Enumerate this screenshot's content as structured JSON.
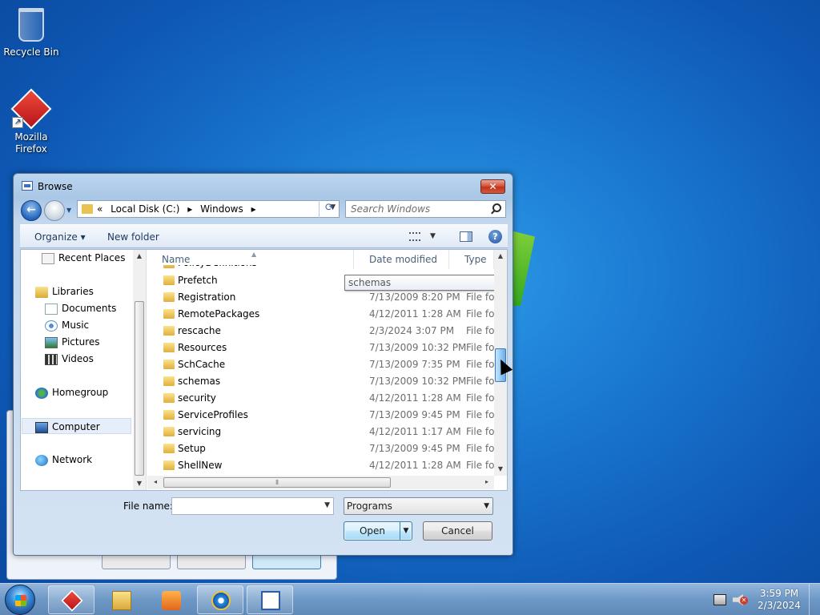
{
  "desktop": {
    "icons": [
      {
        "label": "Recycle Bin"
      },
      {
        "label": "Mozilla Firefox"
      }
    ]
  },
  "dialog": {
    "title": "Browse",
    "close_glyph": "✕",
    "address": {
      "overflow": "«",
      "crumbs": [
        "Local Disk (C:)",
        "Windows"
      ],
      "separator": "▸"
    },
    "search_placeholder": "Search Windows",
    "toolbar": {
      "organize": "Organize ▾",
      "new_folder": "New folder",
      "help": "?"
    },
    "nav_pane": {
      "items": [
        {
          "label": "Recent Places",
          "icon": "recent-places-icon"
        },
        {
          "label": "Libraries",
          "icon": "libraries-icon"
        },
        {
          "label": "Documents",
          "icon": "documents-icon"
        },
        {
          "label": "Music",
          "icon": "music-icon"
        },
        {
          "label": "Pictures",
          "icon": "pictures-icon"
        },
        {
          "label": "Videos",
          "icon": "videos-icon"
        },
        {
          "label": "Homegroup",
          "icon": "homegroup-icon"
        },
        {
          "label": "Computer",
          "icon": "computer-icon",
          "selected": true
        },
        {
          "label": "Network",
          "icon": "network-icon"
        }
      ]
    },
    "columns": {
      "name": "Name",
      "date": "Date modified",
      "type": "Type"
    },
    "tooltip": "schemas",
    "files": [
      {
        "name": "PolicyDefinitions",
        "date": "",
        "type": ""
      },
      {
        "name": "Prefetch",
        "date": "",
        "type": ""
      },
      {
        "name": "Registration",
        "date": "7/13/2009 8:20 PM",
        "type": "File fol"
      },
      {
        "name": "RemotePackages",
        "date": "4/12/2011 1:28 AM",
        "type": "File fol"
      },
      {
        "name": "rescache",
        "date": "2/3/2024 3:07 PM",
        "type": "File fol"
      },
      {
        "name": "Resources",
        "date": "7/13/2009 10:32 PM",
        "type": "File fol"
      },
      {
        "name": "SchCache",
        "date": "7/13/2009 7:35 PM",
        "type": "File fol"
      },
      {
        "name": "schemas",
        "date": "7/13/2009 10:32 PM",
        "type": "File fol"
      },
      {
        "name": "security",
        "date": "4/12/2011 1:28 AM",
        "type": "File fol"
      },
      {
        "name": "ServiceProfiles",
        "date": "7/13/2009 9:45 PM",
        "type": "File fol"
      },
      {
        "name": "servicing",
        "date": "4/12/2011 1:17 AM",
        "type": "File fol"
      },
      {
        "name": "Setup",
        "date": "7/13/2009 9:45 PM",
        "type": "File fol"
      },
      {
        "name": "ShellNew",
        "date": "4/12/2011 1:28 AM",
        "type": "File fol"
      }
    ],
    "file_name_label": "File name:",
    "file_name_value": "",
    "filter": "Programs",
    "open_label": "Open",
    "cancel_label": "Cancel"
  },
  "taskbar": {
    "time": "3:59 PM",
    "date": "2/3/2024"
  }
}
